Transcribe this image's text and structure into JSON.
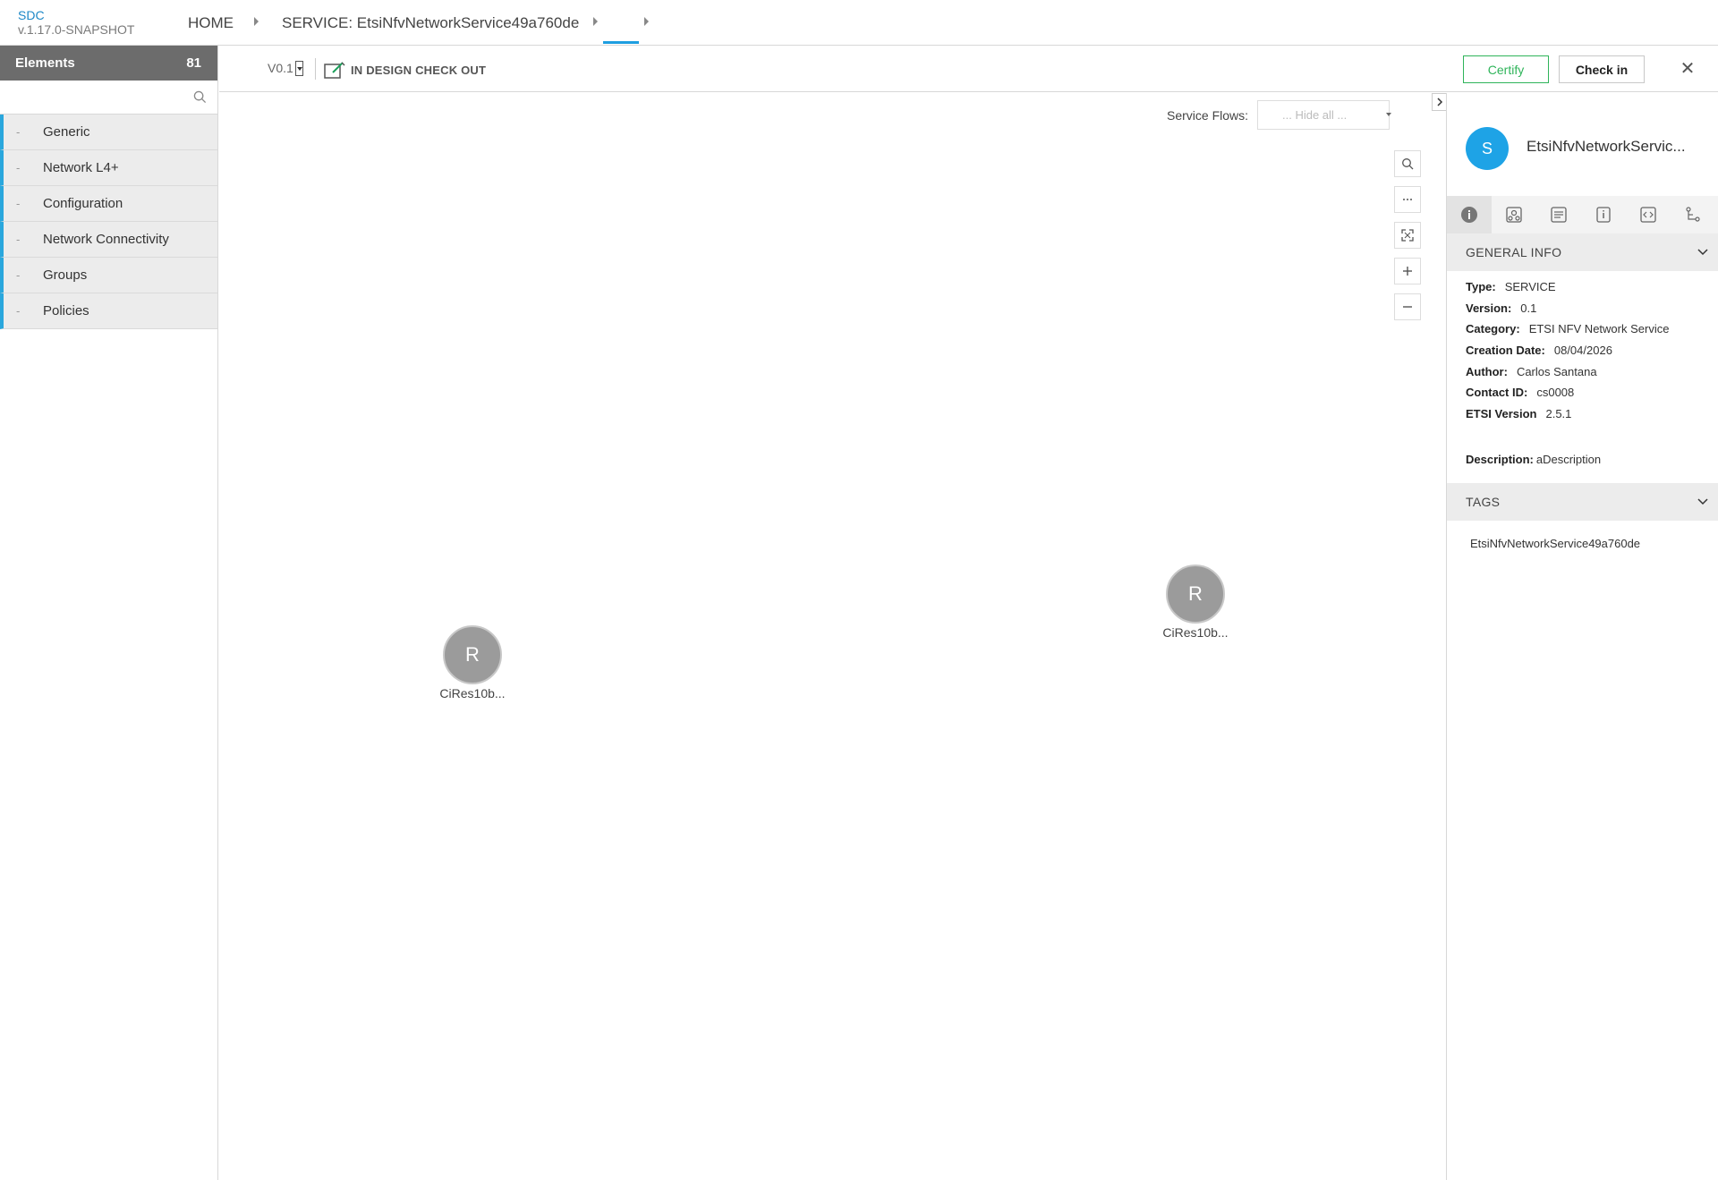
{
  "topbar": {
    "brand_name": "SDC",
    "brand_version": "v.1.17.0-SNAPSHOT",
    "crumb_home": "HOME",
    "crumb_service": "SERVICE: EtsiNfvNetworkService49a760de"
  },
  "left_panel": {
    "title": "Elements",
    "count": "81",
    "search_placeholder": "",
    "categories": [
      {
        "dash": "-",
        "label": "Generic"
      },
      {
        "dash": "-",
        "label": "Network L4+"
      },
      {
        "dash": "-",
        "label": "Configuration"
      },
      {
        "dash": "-",
        "label": "Network Connectivity"
      },
      {
        "dash": "-",
        "label": "Groups"
      },
      {
        "dash": "-",
        "label": "Policies"
      }
    ]
  },
  "toolbar": {
    "version": "V0.1",
    "status": "IN DESIGN CHECK OUT",
    "certify_label": "Certify",
    "checkin_label": "Check in",
    "close_label": "✕"
  },
  "canvas": {
    "service_flows_label": "Service Flows:",
    "service_flows_value": "... Hide all ...",
    "nodes": [
      {
        "letter": "R",
        "label": "CiRes10b..."
      },
      {
        "letter": "R",
        "label": "CiRes10b..."
      }
    ]
  },
  "right_panel": {
    "avatar_letter": "S",
    "service_name": "EtsiNfvNetworkServic...",
    "general_info_title": "GENERAL INFO",
    "info": [
      {
        "key": "Type:",
        "value": "SERVICE"
      },
      {
        "key": "Version:",
        "value": "0.1"
      },
      {
        "key": "Category:",
        "value": "ETSI NFV Network Service"
      },
      {
        "key": "Creation Date:",
        "value": "08/04/2026"
      },
      {
        "key": "Author:",
        "value": "Carlos Santana"
      },
      {
        "key": "Contact ID:",
        "value": "cs0008"
      },
      {
        "key": "ETSI Version",
        "value": "2.5.1"
      }
    ],
    "description_key": "Description:",
    "description_value": "aDescription",
    "tags_title": "TAGS",
    "tag": "EtsiNfvNetworkService49a760de"
  },
  "colors": {
    "accent": "#1e9ee0",
    "certify_green": "#2fb45a",
    "node_gray": "#9b9b9b",
    "left_header": "#6c6c6c"
  },
  "icons": [
    "search-icon",
    "checkout-edit-icon",
    "zoom-search-icon",
    "more-icon",
    "fit-screen-icon",
    "zoom-in-icon",
    "zoom-out-icon",
    "info-icon",
    "composition-icon",
    "properties-icon",
    "details-icon",
    "api-icon",
    "flow-icon",
    "chevron-down-icon",
    "close-icon"
  ]
}
